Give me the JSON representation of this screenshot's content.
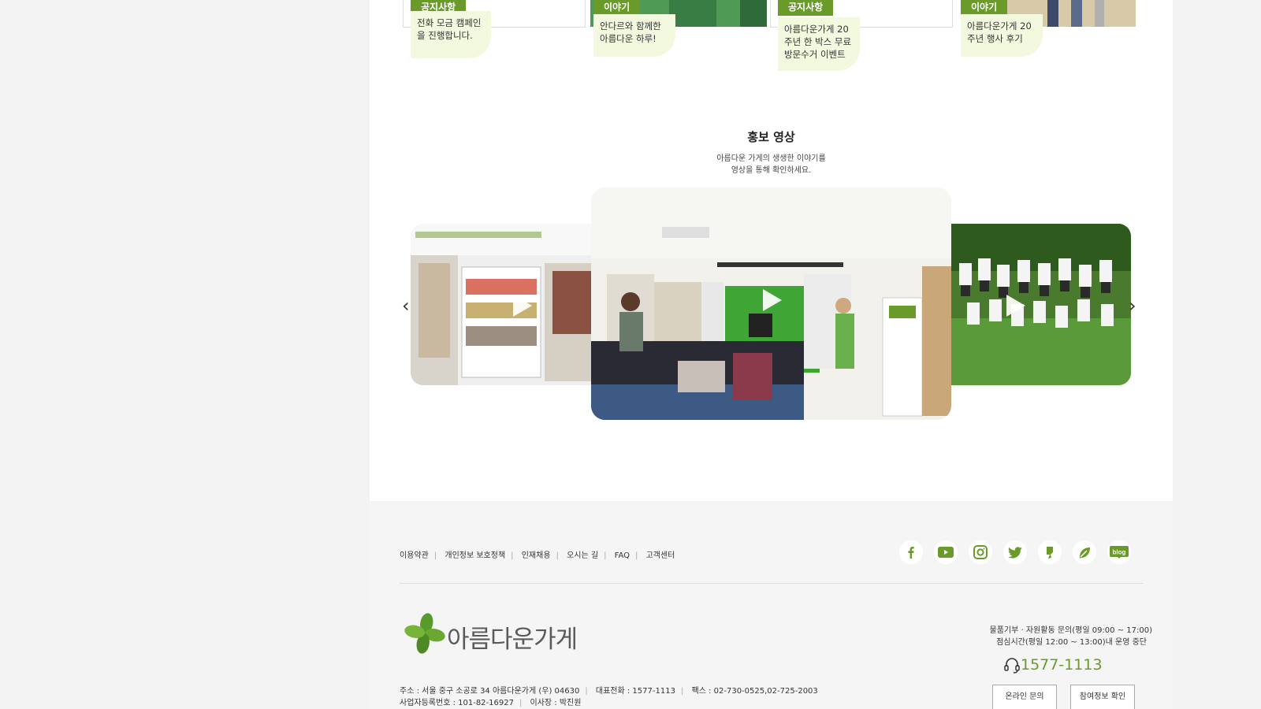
{
  "news": [
    {
      "tag": "공지사항",
      "text": [
        "전화 모금 캠페인",
        "을 진행합니다."
      ]
    },
    {
      "tag": "이야기",
      "text": [
        "안다르와 함께한",
        "아름다운 하루!"
      ]
    },
    {
      "tag": "공지사항",
      "text": [
        "아름다운가게 20",
        "주년 한 박스 무료",
        "방문수거 이벤트"
      ]
    },
    {
      "tag": "이야기",
      "text": [
        "아름다운가게 20",
        "주년 행사 후기"
      ]
    }
  ],
  "promo": {
    "title": "홍보 영상",
    "subtitle_line1": "아름다운 가게의 생생한 이야기를",
    "subtitle_line2": "영상을 통해 확인하세요."
  },
  "video_caption_store": "아름다운가게",
  "footer": {
    "links": [
      "이용약관",
      "개인정보 보호정책",
      "인재채용",
      "오시는 길",
      "FAQ",
      "고객센터"
    ],
    "social": [
      "facebook-icon",
      "youtube-icon",
      "instagram-icon",
      "twitter-icon",
      "kakao-story-icon",
      "leaf-icon",
      "blog-icon"
    ],
    "blog_label": "blog",
    "logo_text": "아름다운가게",
    "address": "주소 : 서울 중구 소공로 34 아름다운가게 (우) 04630",
    "tel": "대표전화 : 1577-1113",
    "fax": "팩스 : 02-730-0525,02-725-2003",
    "biz_no": "사업자등록번호 : 101-82-16927",
    "ceo": "이사장 : 박진원",
    "cs_line1": "물품기부 · 자원활동 문의(평일 09:00 ~ 17:00)",
    "cs_line2": "점심시간(평일 12:00 ~ 13:00)내 운영 중단",
    "phone": "1577-1113",
    "btn_online": "온라인 문의",
    "btn_participation": "참여정보 확인"
  },
  "colors": {
    "accent": "#6a9a2a",
    "note_bg": "#f2f9de"
  }
}
